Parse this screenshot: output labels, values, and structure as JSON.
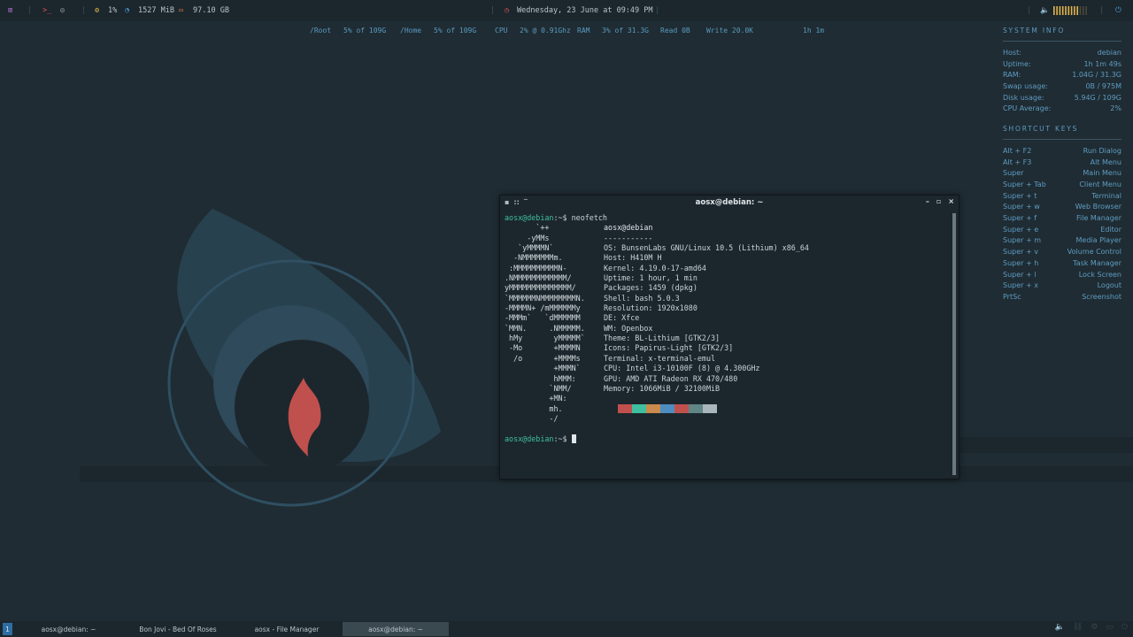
{
  "topbar": {
    "cpu_percent": "1%",
    "mem_used": "1527 MiB",
    "disk_free": "97.10 GB",
    "datetime": "Wednesday, 23 June at 09:49 PM",
    "volume_level": 0.75
  },
  "conky_line": {
    "root_label": "/Root",
    "root_value": "5% of 109G",
    "home_label": "/Home",
    "home_value": "5% of 109G",
    "cpu_label": "CPU",
    "cpu_value": "2% @ 0.91Ghz",
    "ram_label": "RAM",
    "ram_value": "3% of 31.3G",
    "read": "Read 0B",
    "write": "Write 20.0K",
    "uptime": "1h 1m"
  },
  "system_info": {
    "heading": "SYSTEM INFO",
    "rows": [
      {
        "label": "Host:",
        "value": "debian"
      },
      {
        "label": "Uptime:",
        "value": "1h 1m 49s"
      },
      {
        "label": "RAM:",
        "value": "1.04G / 31.3G"
      },
      {
        "label": "Swap usage:",
        "value": "0B / 975M"
      },
      {
        "label": "Disk usage:",
        "value": "5.94G / 109G"
      },
      {
        "label": "CPU Average:",
        "value": "2%"
      }
    ]
  },
  "shortcuts": {
    "heading": "SHORTCUT KEYS",
    "rows": [
      {
        "label": "Alt + F2",
        "value": "Run Dialog"
      },
      {
        "label": "Alt + F3",
        "value": "Alt Menu"
      },
      {
        "label": "Super",
        "value": "Main Menu"
      },
      {
        "label": "Super + Tab",
        "value": "Client Menu"
      },
      {
        "label": "Super + t",
        "value": "Terminal"
      },
      {
        "label": "Super + w",
        "value": "Web Browser"
      },
      {
        "label": "Super + f",
        "value": "File Manager"
      },
      {
        "label": "Super + e",
        "value": "Editor"
      },
      {
        "label": "Super + m",
        "value": "Media Player"
      },
      {
        "label": "Super + v",
        "value": "Volume Control"
      },
      {
        "label": "Super + h",
        "value": "Task Manager"
      },
      {
        "label": "Super + l",
        "value": "Lock Screen"
      },
      {
        "label": "Super + x",
        "value": "Logout"
      },
      {
        "label": "PrtSc",
        "value": "Screenshot"
      }
    ]
  },
  "terminal": {
    "title": "aosx@debian: ~",
    "prompt_user": "aosx@debian",
    "prompt_path": ":~$ ",
    "command": "neofetch",
    "art": [
      "       `++",
      "     -yMMs",
      "   `yMMMMN`",
      "  -NMMMMMMMm.",
      " :MMMMMMMMMMN-",
      ".NMMMMMMMMMMMM/",
      "yMMMMMMMMMMMMMM/",
      "`MMMMMMNMMMMMMMMN.",
      "-MMMMN+ /mMMMMMMy",
      "-MMMm`   `dMMMMMM",
      "`MMN.     .NMMMMM.",
      " hMy       yMMMMM`",
      " -Mo       +MMMMN",
      "  /o       +MMMMs",
      "           +MMMN`",
      "           hMMM:",
      "          `NMM/",
      "          +MN:",
      "          mh.",
      "          -/"
    ],
    "info": [
      "aosx@debian",
      "-----------",
      "OS: BunsenLabs GNU/Linux 10.5 (Lithium) x86_64",
      "Host: H410M H",
      "Kernel: 4.19.0-17-amd64",
      "Uptime: 1 hour, 1 min",
      "Packages: 1459 (dpkg)",
      "Shell: bash 5.0.3",
      "Resolution: 1920x1080",
      "DE: Xfce",
      "WM: Openbox",
      "Theme: BL-Lithium [GTK2/3]",
      "Icons: Papirus-Light [GTK2/3]",
      "Terminal: x-terminal-emul",
      "CPU: Intel i3-10100F (8) @ 4.300GHz",
      "GPU: AMD ATI Radeon RX 470/480",
      "Memory: 1066MiB / 32100MiB"
    ],
    "palette": [
      "#1c272d",
      "#c0504d",
      "#3fbf9f",
      "#c98a4b",
      "#4d8dc0",
      "#c0504d",
      "#5f8585",
      "#a9b6bc"
    ]
  },
  "taskbar": {
    "workspace": "1",
    "tasks": [
      {
        "label": "aosx@debian: ~",
        "active": false
      },
      {
        "label": "Bon Jovi - Bed Of Roses",
        "active": false
      },
      {
        "label": "aosx - File Manager",
        "active": false
      },
      {
        "label": "aosx@debian: ~",
        "active": true
      }
    ]
  },
  "colors": {
    "background": "#1f2c33",
    "accent": "#5f9cc2",
    "flame": "#c0504d"
  }
}
